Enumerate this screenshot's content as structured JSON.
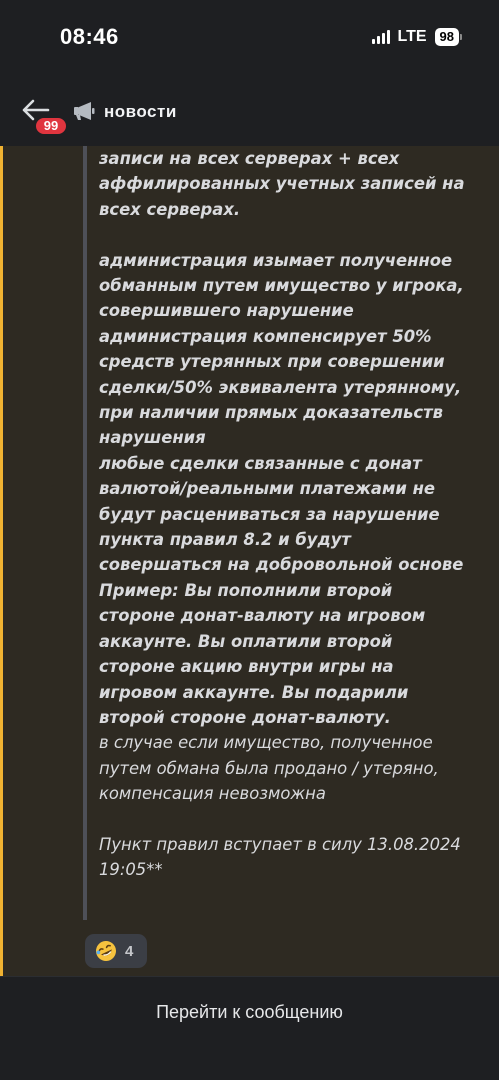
{
  "status_bar": {
    "time": "08:46",
    "network": "LTE",
    "battery": "98"
  },
  "header": {
    "back_icon": "arrow-left-icon",
    "unread_badge": "99",
    "channel_icon": "megaphone-icon",
    "channel_name": "новости"
  },
  "message": {
    "lines_bold": [
      "записи на всех серверах + всех",
      "аффилированных учетных записей на",
      "всех серверах."
    ],
    "block2": [
      "администрация изымает полученное",
      "обманным путем имущество у игрока,",
      "совершившего нарушение",
      "администрация компенсирует 50%",
      "средств утерянных при совершении",
      "сделки/50% эквивалента утерянному,",
      "при наличии прямых доказательств",
      "нарушения",
      "любые сделки связанные с донат",
      "валютой/реальными платежами не",
      "будут расцениваться за нарушение",
      "пункта правил 8.2 и будут",
      "совершаться на добровольной основе",
      "Пример: Вы пополнили второй",
      "стороне донат-валюту на игровом",
      "аккаунте. Вы оплатили второй",
      "стороне акцию внутри игры на",
      "игровом аккаунте. Вы подарили",
      "второй стороне донат-валюту."
    ],
    "block3": [
      "в случае если имущество, полученное",
      "путем обмана была продано / утеряно,",
      "компенсация невозможна"
    ],
    "footer_lines": [
      "Пункт правил вступает в силу 13.08.2024",
      "19:05**"
    ]
  },
  "reaction": {
    "emoji": "rolling-on-floor-laughing-emoji",
    "count": "4"
  },
  "bottom": {
    "jump_label": "Перейти к сообщению"
  },
  "colors": {
    "background": "#1e1f22",
    "highlight_bg": "#2e2a22",
    "highlight_bar": "#f0b232",
    "badge": "#e0353f"
  }
}
